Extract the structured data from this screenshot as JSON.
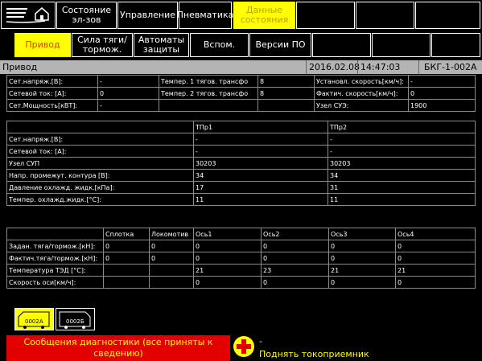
{
  "nav_top": {
    "tabs": [
      {
        "label": "Состояние эл-зов"
      },
      {
        "label": "Управление"
      },
      {
        "label": "Пневматика"
      },
      {
        "label": "Данные состояния"
      }
    ]
  },
  "nav_sub": {
    "tabs": [
      {
        "label": "Привод"
      },
      {
        "label": "Сила тяги/ тормож."
      },
      {
        "label": "Автоматы защиты"
      },
      {
        "label": "Вспом."
      },
      {
        "label": "Версии ПО"
      }
    ]
  },
  "titlebar": {
    "title": "Привод",
    "date": "2016.02.08",
    "time": "14:47:03",
    "loco": "БКГ-1-002А"
  },
  "summary": {
    "rows": [
      [
        "Сет.напряж.[В]:",
        "-",
        "Темпер. 1 тягов. трансфо",
        "8",
        "Установл. скорость[км/ч]:",
        "-"
      ],
      [
        "Сетевой ток: [А]:",
        "0",
        "Темпер. 2 тягов. трансфо",
        "8",
        "Фактич. скорость[км/ч]:",
        "0"
      ],
      [
        "Сет.Мощность[кВТ]:",
        "-",
        "",
        "",
        "Узел СУЭ:",
        "1900"
      ]
    ]
  },
  "converters": {
    "headers": [
      "",
      "ТПр1",
      "ТПр2"
    ],
    "rows": [
      [
        "Сет.напряж.[В]:",
        "-",
        "-"
      ],
      [
        "Сетевой ток: [А]:",
        "-",
        "-"
      ],
      [
        "Узел СУП",
        "30203",
        "30203"
      ],
      [
        "Напр. промежут. контура [В]:",
        "34",
        "34"
      ],
      [
        "Давление охлажд. жидк.[кПа]:",
        "17",
        "31"
      ],
      [
        "Темпер. охлажд.жидк.[°C]:",
        "11",
        "11"
      ]
    ]
  },
  "axles": {
    "headers": [
      "",
      "Сплотка",
      "Локомотив",
      "Ось1",
      "Ось2",
      "Ось3",
      "Ось4"
    ],
    "rows": [
      [
        "Задан. тяга/тормож.[кН]:",
        "0",
        "0",
        "0",
        "0",
        "0",
        "0"
      ],
      [
        "Фактич.тяга/тормож.[кН]:",
        "0",
        "0",
        "0",
        "0",
        "0",
        "0"
      ],
      [
        "Температура ТЭД [°C]:",
        "",
        "",
        "21",
        "23",
        "21",
        "21"
      ],
      [
        "Скорость оси[км/ч]:",
        "",
        "",
        "0",
        "0",
        "0",
        "0"
      ]
    ]
  },
  "locos": [
    {
      "label": "0002А"
    },
    {
      "label": "0002Б"
    }
  ],
  "bottom": {
    "alarm": "Сообщения диагностики (все приняты к сведению)",
    "msg_line1": "-",
    "msg_line2": "Поднять токоприемник"
  }
}
